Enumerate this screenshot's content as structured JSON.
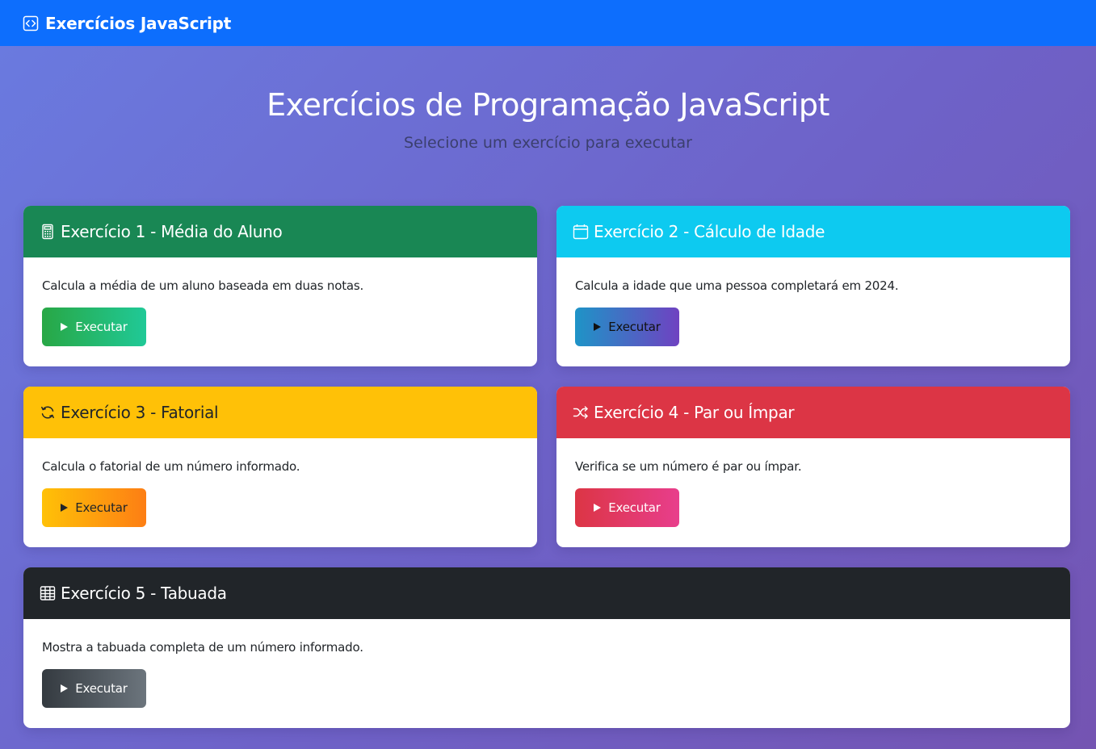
{
  "navbar": {
    "brand": "Exercícios JavaScript",
    "icon": "code-square-icon"
  },
  "hero": {
    "title": "Exercícios de Programação JavaScript",
    "subtitle": "Selecione um exercício para executar"
  },
  "exercises": [
    {
      "title": "Exercício 1 - Média do Aluno",
      "description": "Calcula a média de um aluno baseada em duas notas.",
      "button": "Executar",
      "icon": "calculator-icon",
      "color": "#198754"
    },
    {
      "title": "Exercício 2 - Cálculo de Idade",
      "description": "Calcula a idade que uma pessoa completará em 2024.",
      "button": "Executar",
      "icon": "calendar-icon",
      "color": "#0dcaf0"
    },
    {
      "title": "Exercício 3 - Fatorial",
      "description": "Calcula o fatorial de um número informado.",
      "button": "Executar",
      "icon": "arrow-repeat-icon",
      "color": "#ffc107"
    },
    {
      "title": "Exercício 4 - Par ou Ímpar",
      "description": "Verifica se um número é par ou ímpar.",
      "button": "Executar",
      "icon": "shuffle-icon",
      "color": "#dc3545"
    },
    {
      "title": "Exercício 5 - Tabuada",
      "description": "Mostra a tabuada completa de um número informado.",
      "button": "Executar",
      "icon": "table-icon",
      "color": "#212529"
    }
  ]
}
